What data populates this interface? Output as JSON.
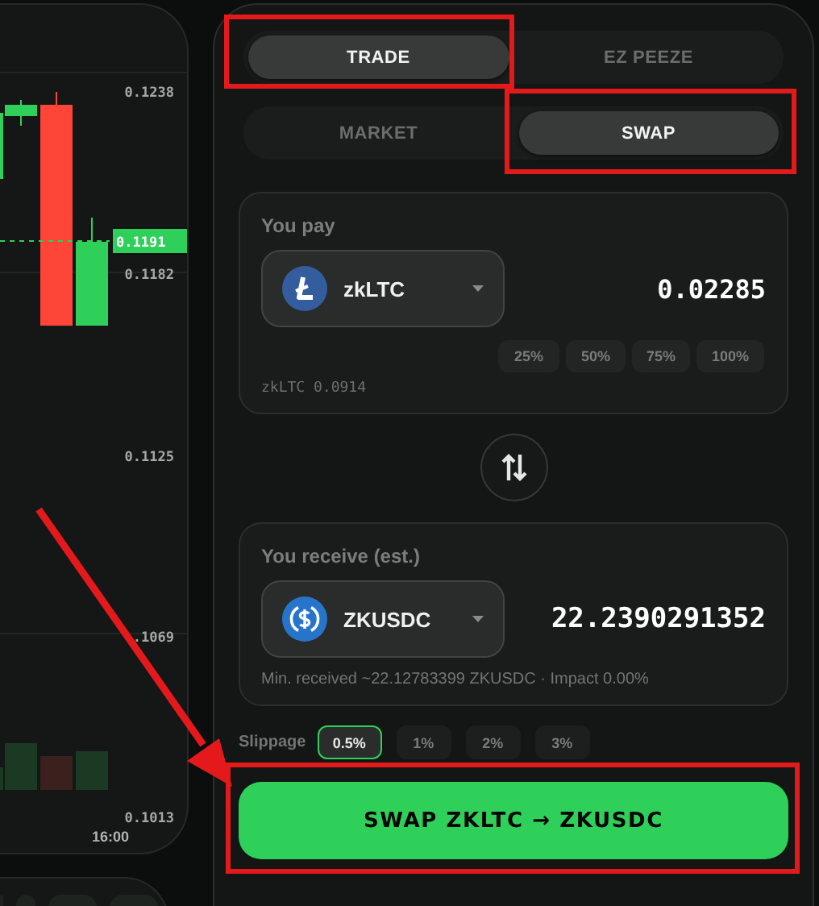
{
  "chart": {
    "price_labels": [
      "0.1238",
      "0.1182",
      "0.1125",
      ".1069",
      "0.1013"
    ],
    "current_price": "0.1191",
    "time_label": "16:00"
  },
  "mode_tabs": [
    {
      "label": "TRADE",
      "selected": true,
      "highlighted": true
    },
    {
      "label": "EZ PEEZE",
      "selected": false,
      "highlighted": false
    }
  ],
  "order_tabs": [
    {
      "label": "MARKET",
      "selected": false,
      "highlighted": false
    },
    {
      "label": "SWAP",
      "selected": true,
      "highlighted": true
    }
  ],
  "pay": {
    "label": "You pay",
    "token": {
      "symbol": "zkLTC",
      "kind": "litecoin"
    },
    "amount": "0.02285",
    "percent_buttons": [
      "25%",
      "50%",
      "75%",
      "100%"
    ],
    "balance": "zkLTC 0.0914"
  },
  "receive": {
    "label": "You receive (est.)",
    "token": {
      "symbol": "ZKUSDC",
      "kind": "usdc"
    },
    "amount": "22.2390291352",
    "details": "Min. received ~22.12783399 ZKUSDC · Impact 0.00%"
  },
  "slippage": {
    "label": "Slippage",
    "options": [
      {
        "label": "0.5%",
        "selected": true
      },
      {
        "label": "1%",
        "selected": false
      },
      {
        "label": "2%",
        "selected": false
      },
      {
        "label": "3%",
        "selected": false
      }
    ]
  },
  "swap_button": {
    "label": "SWAP ZKLTC → ZKUSDC",
    "highlighted": true
  },
  "pointer_arrow": {
    "shown": true
  }
}
